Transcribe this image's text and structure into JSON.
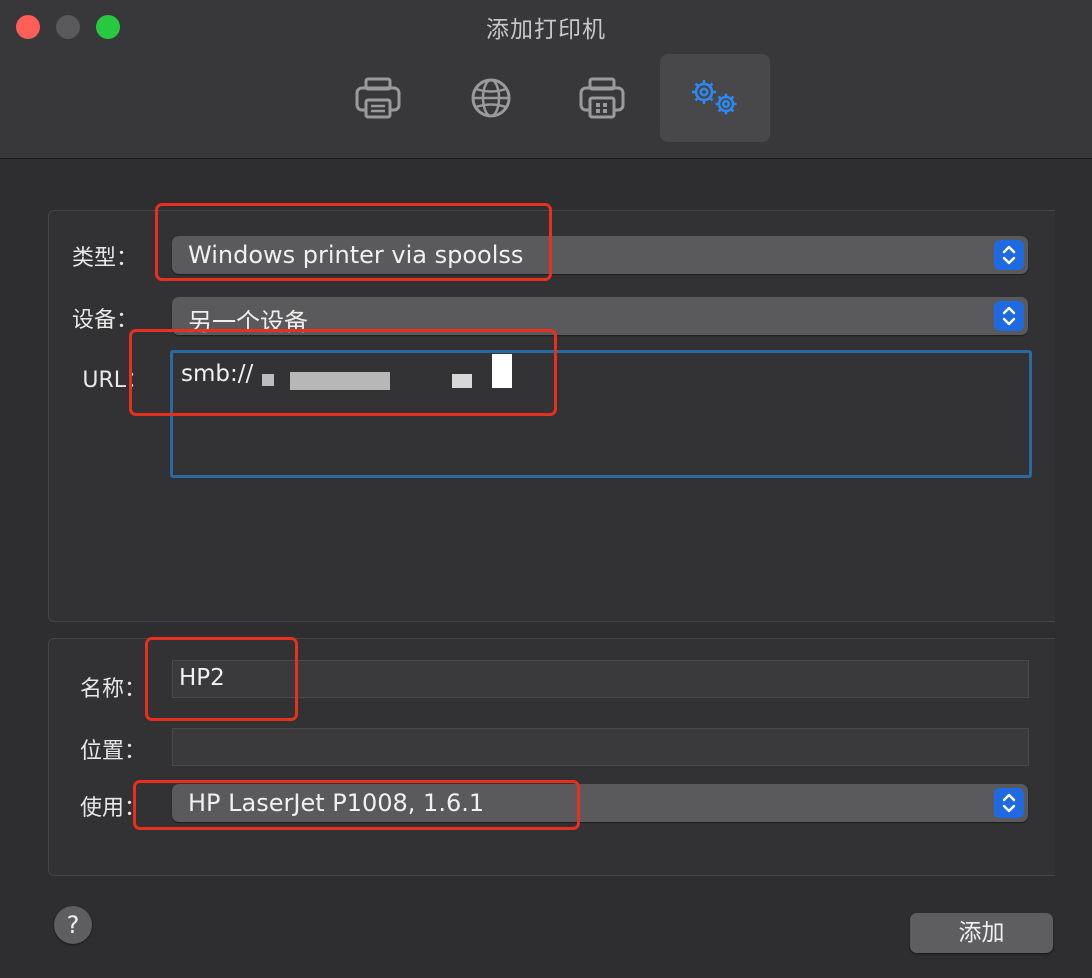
{
  "window": {
    "title": "添加打印机"
  },
  "toolbar": {
    "tabs": [
      {
        "icon": "printer-icon",
        "active": false
      },
      {
        "icon": "globe-icon",
        "active": false
      },
      {
        "icon": "windows-printer-icon",
        "active": false
      },
      {
        "icon": "gears-icon",
        "active": true
      }
    ]
  },
  "form": {
    "type_label": "类型：",
    "type_value": "Windows printer via spoolss",
    "device_label": "设备：",
    "device_value": "另一个设备",
    "url_label": "URL：",
    "url_value": "smb://"
  },
  "details": {
    "name_label": "名称：",
    "name_value": "HP2",
    "location_label": "位置：",
    "location_value": "",
    "use_label": "使用：",
    "use_value": "HP LaserJet P1008, 1.6.1"
  },
  "footer": {
    "help_label": "?",
    "add_label": "添加"
  },
  "colors": {
    "accent": "#1f6ae0",
    "highlight": "#e8301e",
    "focus_ring": "#2b6aa0"
  }
}
